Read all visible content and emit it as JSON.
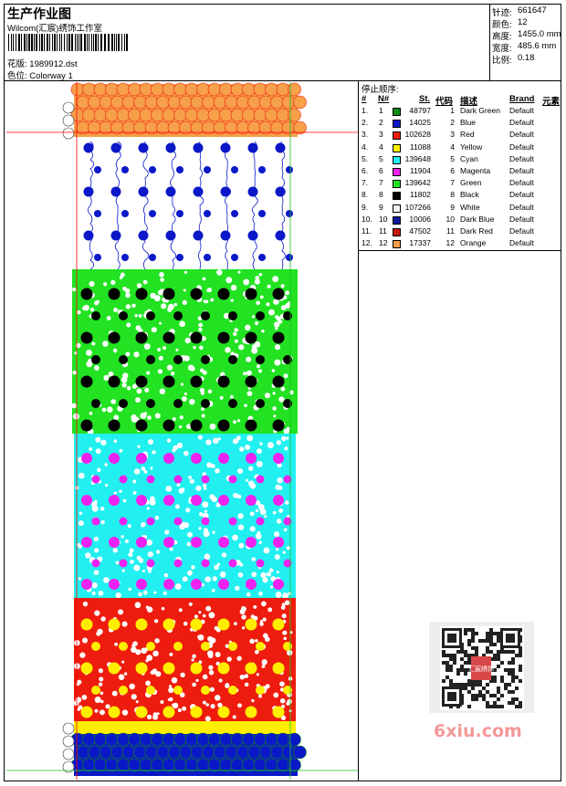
{
  "title": "生产作业图",
  "company": "Wilcom(汇宸)绣饰工作室",
  "design_file": {
    "label": "花版:",
    "value": "1989912.dst"
  },
  "colorway": {
    "label": "色位:",
    "value": "Colorway 1"
  },
  "stats": [
    {
      "label": "针迹:",
      "value": "661647"
    },
    {
      "label": "颜色:",
      "value": "12"
    },
    {
      "label": "高度:",
      "value": "1455.0 mm"
    },
    {
      "label": "宽度:",
      "value": "485.6 mm"
    },
    {
      "label": "比例:",
      "value": "0.18"
    }
  ],
  "stop_sequence": {
    "title": "停止顺序:",
    "headers": {
      "idx": "#",
      "n": "N#",
      "st": "St.",
      "code": "代码",
      "desc": "描述",
      "brand": "Brand",
      "element": "元素"
    },
    "rows": [
      {
        "idx": "1.",
        "n": "1",
        "st": "48797",
        "code": "1",
        "desc": "Dark Green",
        "brand": "Default",
        "color": "#108a10"
      },
      {
        "idx": "2.",
        "n": "2",
        "st": "14025",
        "code": "2",
        "desc": "Blue",
        "brand": "Default",
        "color": "#0a18c8"
      },
      {
        "idx": "3.",
        "n": "3",
        "st": "102628",
        "code": "3",
        "desc": "Red",
        "brand": "Default",
        "color": "#ee1c0e"
      },
      {
        "idx": "4.",
        "n": "4",
        "st": "11088",
        "code": "4",
        "desc": "Yellow",
        "brand": "Default",
        "color": "#ffee00"
      },
      {
        "idx": "5.",
        "n": "5",
        "st": "139648",
        "code": "5",
        "desc": "Cyan",
        "brand": "Default",
        "color": "#22f0f0"
      },
      {
        "idx": "6.",
        "n": "6",
        "st": "11904",
        "code": "6",
        "desc": "Magenta",
        "brand": "Default",
        "color": "#ee22ee"
      },
      {
        "idx": "7.",
        "n": "7",
        "st": "139642",
        "code": "7",
        "desc": "Green",
        "brand": "Default",
        "color": "#22e222"
      },
      {
        "idx": "8.",
        "n": "8",
        "st": "11802",
        "code": "8",
        "desc": "Black",
        "brand": "Default",
        "color": "#000000"
      },
      {
        "idx": "9.",
        "n": "9",
        "st": "107266",
        "code": "9",
        "desc": "White",
        "brand": "Default",
        "color": "#f4f4f4"
      },
      {
        "idx": "10.",
        "n": "10",
        "st": "10006",
        "code": "10",
        "desc": "Dark Blue",
        "brand": "Default",
        "color": "#0a1a9a"
      },
      {
        "idx": "11.",
        "n": "11",
        "st": "47502",
        "code": "11",
        "desc": "Dark Red",
        "brand": "Default",
        "color": "#c41a0a"
      },
      {
        "idx": "12.",
        "n": "12",
        "st": "17337",
        "code": "12",
        "desc": "Orange",
        "brand": "Default",
        "color": "#f7a04a"
      }
    ]
  },
  "watermark": "6xiu.com",
  "qr_stamp": "汇宸绣饰"
}
